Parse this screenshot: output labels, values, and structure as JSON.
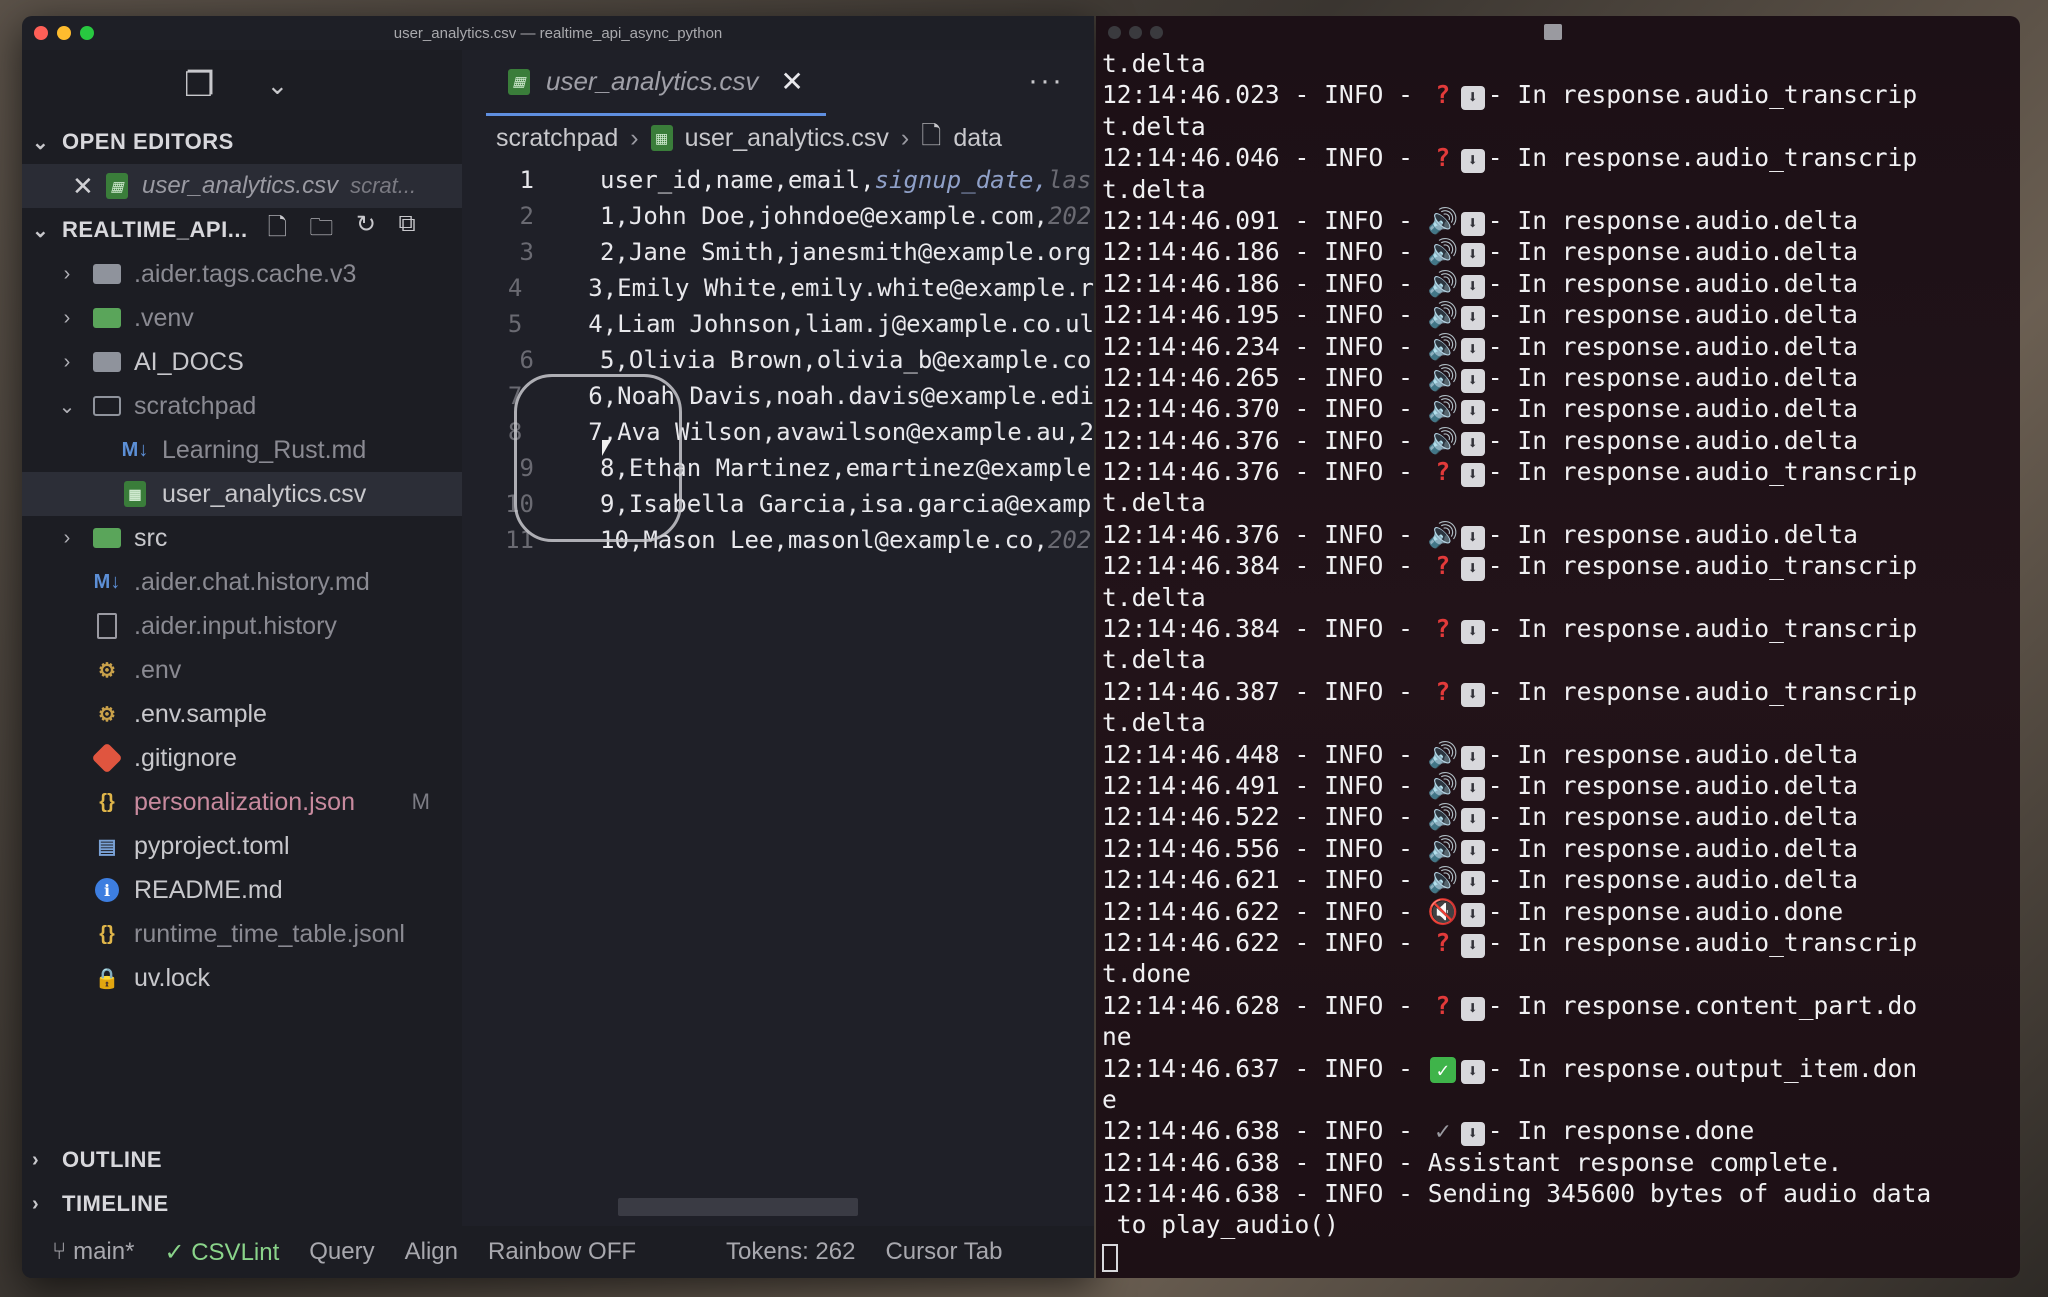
{
  "window": {
    "title": "user_analytics.csv — realtime_api_async_python"
  },
  "sidebar": {
    "open_editors": {
      "label": "OPEN EDITORS",
      "file": "user_analytics.csv",
      "path": "scrat..."
    },
    "project": {
      "label": "REALTIME_API...",
      "items": [
        {
          "name": ".aider.tags.cache.v3",
          "kind": "folder",
          "state": "collapsed"
        },
        {
          "name": ".venv",
          "kind": "folder-green",
          "state": "collapsed"
        },
        {
          "name": "AI_DOCS",
          "kind": "folder",
          "state": "collapsed"
        },
        {
          "name": "scratchpad",
          "kind": "folder-open",
          "state": "expanded"
        },
        {
          "name": "Learning_Rust.md",
          "kind": "md",
          "indent": 2
        },
        {
          "name": "user_analytics.csv",
          "kind": "csv",
          "indent": 2
        },
        {
          "name": "src",
          "kind": "folder-green",
          "state": "collapsed"
        },
        {
          "name": ".aider.chat.history.md",
          "kind": "md"
        },
        {
          "name": ".aider.input.history",
          "kind": "file"
        },
        {
          "name": ".env",
          "kind": "env"
        },
        {
          "name": ".env.sample",
          "kind": "env"
        },
        {
          "name": ".gitignore",
          "kind": "git"
        },
        {
          "name": "personalization.json",
          "kind": "json",
          "badge": "M"
        },
        {
          "name": "pyproject.toml",
          "kind": "toml"
        },
        {
          "name": "README.md",
          "kind": "info"
        },
        {
          "name": "runtime_time_table.jsonl",
          "kind": "json"
        },
        {
          "name": "uv.lock",
          "kind": "lock"
        }
      ]
    },
    "outline_label": "OUTLINE",
    "timeline_label": "TIMELINE"
  },
  "editor": {
    "tab": {
      "label": "user_analytics.csv",
      "close": "✕"
    },
    "breadcrumb": [
      "scratchpad",
      "user_analytics.csv",
      "data"
    ],
    "lines": [
      {
        "n": "1",
        "text": "user_id,name,email,",
        "em": "signup_date,",
        "fade": "las"
      },
      {
        "n": "2",
        "text": "1,John Doe,johndoe@example.com,",
        "fade": "202"
      },
      {
        "n": "3",
        "text": "2,Jane Smith,janesmith@example.org"
      },
      {
        "n": "4",
        "text": "3,Emily White,emily.white@example.r"
      },
      {
        "n": "5",
        "text": "4,Liam Johnson,liam.j@example.co.ul"
      },
      {
        "n": "6",
        "text": "5,Olivia Brown,olivia_b@example.co"
      },
      {
        "n": "7",
        "text": "6,Noah Davis,noah.davis@example.edi"
      },
      {
        "n": "8",
        "text": "7,Ava Wilson,avawilson@example.au,2"
      },
      {
        "n": "9",
        "text": "8,Ethan Martinez,emartinez@example"
      },
      {
        "n": "10",
        "text": "9,Isabella Garcia,isa.garcia@examp"
      },
      {
        "n": "11",
        "text": "10,Mason Lee,masonl@example.co,",
        "fade": "202"
      }
    ]
  },
  "statusbar": {
    "branch": "main*",
    "csvlint": "CSVLint",
    "query": "Query",
    "align": "Align",
    "rainbow": "Rainbow OFF",
    "tokens": "Tokens: 262",
    "cursor_tab": "Cursor Tab"
  },
  "terminal": {
    "lines": [
      {
        "t": "t.delta"
      },
      {
        "ts": "12:14:46.023",
        "g": "q",
        "msg": "In response.audio_transcrip"
      },
      {
        "t": "t.delta"
      },
      {
        "ts": "12:14:46.046",
        "g": "q",
        "msg": "In response.audio_transcrip"
      },
      {
        "t": "t.delta"
      },
      {
        "ts": "12:14:46.091",
        "g": "spk",
        "msg": "In response.audio.delta"
      },
      {
        "ts": "12:14:46.186",
        "g": "spk",
        "msg": "In response.audio.delta"
      },
      {
        "ts": "12:14:46.186",
        "g": "spk",
        "msg": "In response.audio.delta"
      },
      {
        "ts": "12:14:46.195",
        "g": "spk",
        "msg": "In response.audio.delta"
      },
      {
        "ts": "12:14:46.234",
        "g": "spk",
        "msg": "In response.audio.delta"
      },
      {
        "ts": "12:14:46.265",
        "g": "spk",
        "msg": "In response.audio.delta"
      },
      {
        "ts": "12:14:46.370",
        "g": "spk",
        "msg": "In response.audio.delta"
      },
      {
        "ts": "12:14:46.376",
        "g": "spk",
        "msg": "In response.audio.delta"
      },
      {
        "ts": "12:14:46.376",
        "g": "q",
        "msg": "In response.audio_transcrip"
      },
      {
        "t": "t.delta"
      },
      {
        "ts": "12:14:46.376",
        "g": "spk",
        "msg": "In response.audio.delta"
      },
      {
        "ts": "12:14:46.384",
        "g": "q",
        "msg": "In response.audio_transcrip"
      },
      {
        "t": "t.delta"
      },
      {
        "ts": "12:14:46.384",
        "g": "q",
        "msg": "In response.audio_transcrip"
      },
      {
        "t": "t.delta"
      },
      {
        "ts": "12:14:46.387",
        "g": "q",
        "msg": "In response.audio_transcrip"
      },
      {
        "t": "t.delta"
      },
      {
        "ts": "12:14:46.448",
        "g": "spk",
        "msg": "In response.audio.delta"
      },
      {
        "ts": "12:14:46.491",
        "g": "spk",
        "msg": "In response.audio.delta"
      },
      {
        "ts": "12:14:46.522",
        "g": "spk",
        "msg": "In response.audio.delta"
      },
      {
        "ts": "12:14:46.556",
        "g": "spk",
        "msg": "In response.audio.delta"
      },
      {
        "ts": "12:14:46.621",
        "g": "spk",
        "msg": "In response.audio.delta"
      },
      {
        "ts": "12:14:46.622",
        "g": "mute",
        "msg": "In response.audio.done"
      },
      {
        "ts": "12:14:46.622",
        "g": "q",
        "msg": "In response.audio_transcrip"
      },
      {
        "t": "t.done"
      },
      {
        "ts": "12:14:46.628",
        "g": "q",
        "msg": "In response.content_part.do"
      },
      {
        "t": "ne"
      },
      {
        "ts": "12:14:46.637",
        "g": "ok",
        "msg": "In response.output_item.don"
      },
      {
        "t": "e"
      },
      {
        "ts": "12:14:46.638",
        "g": "chk",
        "msg": "In response.done"
      },
      {
        "ts": "12:14:46.638",
        "plain": "Assistant response complete."
      },
      {
        "ts": "12:14:46.638",
        "plain": "Sending 345600 bytes of audio data"
      },
      {
        "t": " to play_audio()"
      }
    ]
  }
}
